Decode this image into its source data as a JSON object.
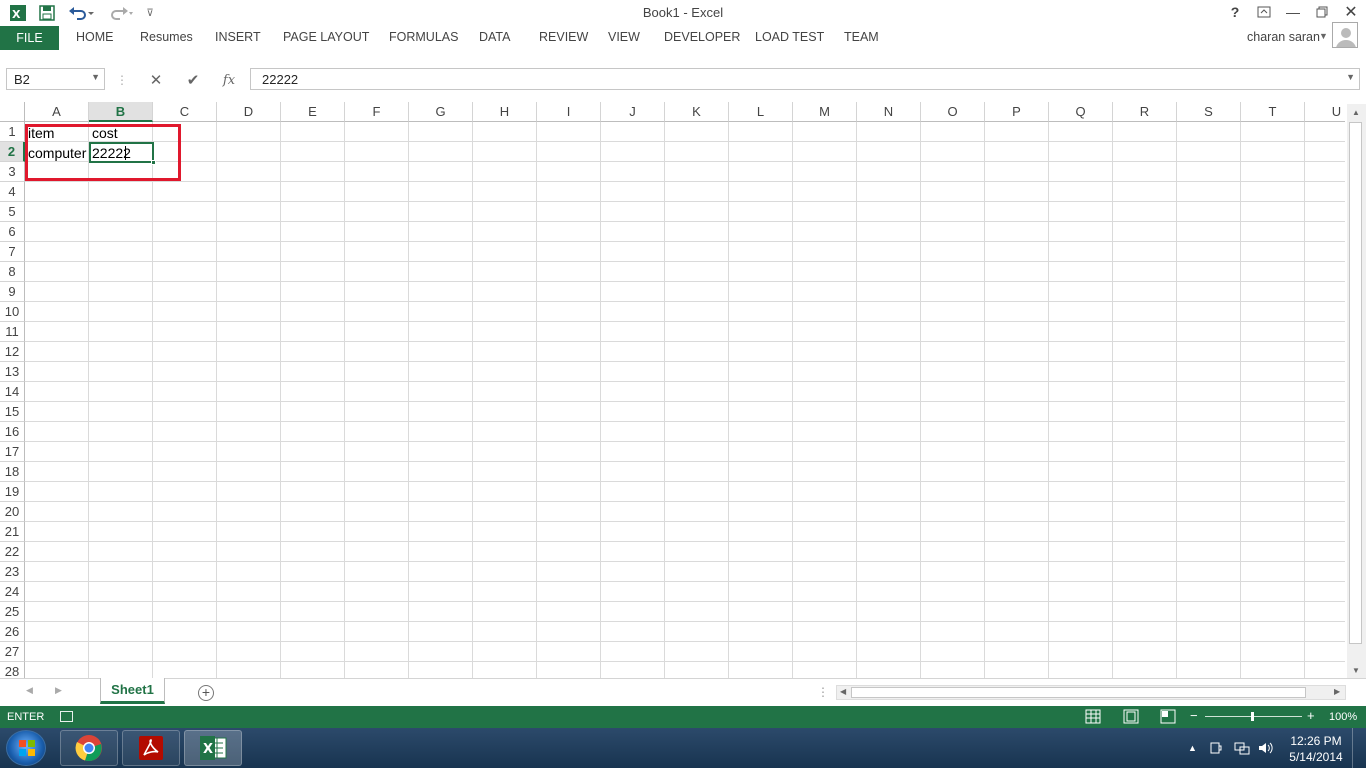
{
  "window": {
    "title": "Book1 - Excel",
    "help": "?",
    "user_name": "charan saran"
  },
  "ribbon": {
    "file_tab": "FILE",
    "tabs": [
      "HOME",
      "Resumes",
      "INSERT",
      "PAGE LAYOUT",
      "FORMULAS",
      "DATA",
      "REVIEW",
      "VIEW",
      "DEVELOPER",
      "LOAD TEST",
      "TEAM"
    ]
  },
  "formula_bar": {
    "name_box": "B2",
    "cancel_icon": "✕",
    "enter_icon": "✔",
    "fx_label": "fx",
    "content": "22222"
  },
  "grid": {
    "columns": [
      "A",
      "B",
      "C",
      "D",
      "E",
      "F",
      "G",
      "H",
      "I",
      "J",
      "K",
      "L",
      "M",
      "N",
      "O",
      "P",
      "Q",
      "R",
      "S",
      "T",
      "U"
    ],
    "rows": [
      "1",
      "2",
      "3",
      "4",
      "5",
      "6",
      "7",
      "8",
      "9",
      "10",
      "11",
      "12",
      "13",
      "14",
      "15",
      "16",
      "17",
      "18",
      "19",
      "20",
      "21",
      "22",
      "23",
      "24",
      "25",
      "26",
      "27",
      "28"
    ],
    "selected_column": "B",
    "selected_row": "2",
    "cells": {
      "A1": "item",
      "B1": "cost",
      "A2": "computer",
      "B2": "22222"
    }
  },
  "sheets": {
    "tabs": [
      "Sheet1"
    ],
    "active": "Sheet1"
  },
  "status_bar": {
    "mode": "ENTER",
    "zoom": "100%",
    "zoom_level": 1.0
  },
  "taskbar": {
    "apps": [
      "Google Chrome",
      "Adobe Acrobat",
      "Excel"
    ],
    "time": "12:26 PM",
    "date": "5/14/2014"
  },
  "colors": {
    "excel_green": "#217346",
    "highlight_red": "#e0182d"
  }
}
